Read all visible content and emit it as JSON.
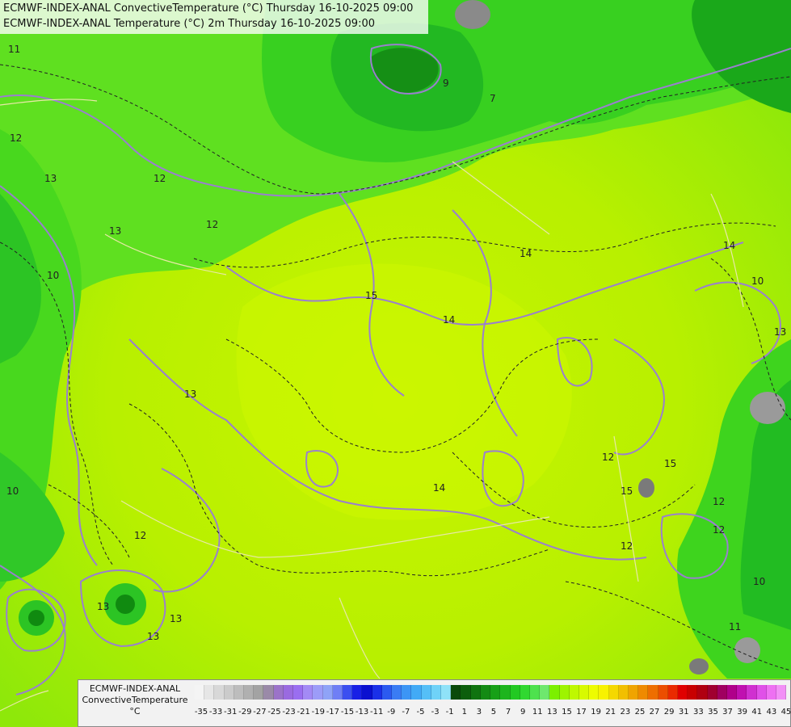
{
  "title": {
    "line1": "ECMWF-INDEX-ANAL ConvectiveTemperature (°C) Thursday 16-10-2025 09:00",
    "line2": "ECMWF-INDEX-ANAL Temperature (°C) 2m Thursday 16-10-2025 09:00"
  },
  "legend": {
    "model": "ECMWF-INDEX-ANAL",
    "variable": "ConvectiveTemperature",
    "unit": "°C",
    "ticks": [
      "-35",
      "-33",
      "-31",
      "-29",
      "-27",
      "-25",
      "-23",
      "-21",
      "-19",
      "-17",
      "-15",
      "-13",
      "-11",
      "-9",
      "-7",
      "-5",
      "-3",
      "-1",
      "1",
      "3",
      "5",
      "7",
      "9",
      "11",
      "13",
      "15",
      "17",
      "19",
      "21",
      "23",
      "25",
      "27",
      "29",
      "31",
      "33",
      "35",
      "37",
      "39",
      "41",
      "43",
      "45"
    ],
    "colors": [
      "#f4f4f4",
      "#e6e6e6",
      "#d8d8d8",
      "#cbcbcb",
      "#bdbdbd",
      "#b0b0b0",
      "#a3a3a3",
      "#9a8aa8",
      "#9b73c9",
      "#9a6ae0",
      "#9a6ef0",
      "#a38af5",
      "#9c9cf8",
      "#8fa3f7",
      "#6f7ff5",
      "#3b4ff0",
      "#1820e6",
      "#0a10d0",
      "#1a30e8",
      "#2b5af0",
      "#3a7cf4",
      "#3c95f5",
      "#42aaf6",
      "#55bff7",
      "#6fd2f8",
      "#8fe2f8",
      "#0a4a0a",
      "#0c5e0c",
      "#0f730f",
      "#138a13",
      "#17a017",
      "#1db51d",
      "#22c922",
      "#30d830",
      "#4ee24e",
      "#6ee86e",
      "#7cf000",
      "#9ef400",
      "#bff800",
      "#d8fa00",
      "#eefc00",
      "#f8f200",
      "#f5d800",
      "#f2bf00",
      "#f0a400",
      "#ef8a00",
      "#ee6e00",
      "#ec4e00",
      "#ea2a00",
      "#e00000",
      "#c80000",
      "#b00010",
      "#a00030",
      "#a00060",
      "#b0008a",
      "#c010b0",
      "#d030d0",
      "#e050e8",
      "#ee70f2",
      "#f290f6"
    ]
  },
  "contour_labels": [
    "11",
    "12",
    "12",
    "13",
    "13",
    "12",
    "10",
    "10",
    "13",
    "12",
    "13",
    "15",
    "14",
    "14",
    "15",
    "14",
    "14",
    "13",
    "15",
    "12",
    "12",
    "12",
    "10",
    "13",
    "13",
    "12",
    "11",
    "9",
    "7",
    "10"
  ]
}
